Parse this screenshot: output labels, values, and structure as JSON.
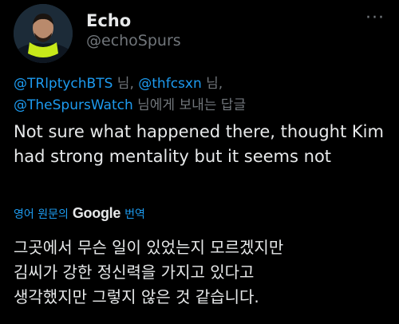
{
  "author": {
    "name": "Echo",
    "handle": "@echoSpurs"
  },
  "menu": {
    "more_label": "···"
  },
  "reply": {
    "mentions_line1": [
      "@TRlptychBTS",
      "@thfcsxn"
    ],
    "mention_line2": "@TheSpursWatch",
    "sep1": " 님, ",
    "sep2": " 님,",
    "suffix": " 님에게 보내는 답글"
  },
  "tweet": {
    "text": "Not sure what happened there, thought Kim had strong mentality but it seems not"
  },
  "translation": {
    "prefix": "영어 원문의",
    "brand": "Google",
    "action": "번역",
    "text_line1": "그곳에서 무슨 일이 있었는지 모르겠지만",
    "text_line2": "김씨가 강한 정신력을 가지고 있다고",
    "text_line3": "생각했지만 그렇지 않은 것 같습니다."
  },
  "colors": {
    "accent": "#1d9bf0",
    "text": "#e7e9ea",
    "muted": "#71767b",
    "background": "#000000"
  }
}
